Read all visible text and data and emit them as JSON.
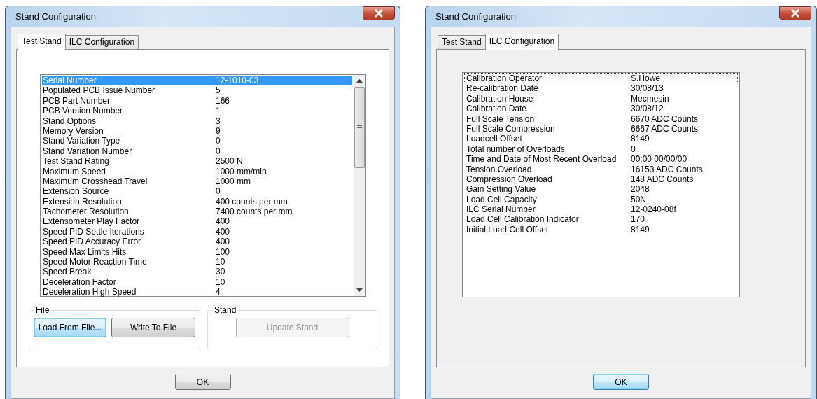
{
  "windows": [
    {
      "title": "Stand Configuration",
      "tabs": [
        {
          "label": "Test Stand",
          "selected": true
        },
        {
          "label": "ILC Configuration",
          "selected": false
        }
      ],
      "list": {
        "scrollbar": true,
        "rows": [
          {
            "name": "Serial Number",
            "value": "12-1010-03",
            "selected": true,
            "focused": false
          },
          {
            "name": "Populated PCB Issue Number",
            "value": "5",
            "selected": false,
            "focused": false
          },
          {
            "name": "PCB Part Number",
            "value": "166",
            "selected": false,
            "focused": false
          },
          {
            "name": "PCB Version Number",
            "value": "1",
            "selected": false,
            "focused": false
          },
          {
            "name": "Stand Options",
            "value": "3",
            "selected": false,
            "focused": false
          },
          {
            "name": "Memory Version",
            "value": "9",
            "selected": false,
            "focused": false
          },
          {
            "name": "Stand Variation Type",
            "value": "0",
            "selected": false,
            "focused": false
          },
          {
            "name": "Stand Variation Number",
            "value": "0",
            "selected": false,
            "focused": false
          },
          {
            "name": "Test Stand Rating",
            "value": "2500 N",
            "selected": false,
            "focused": false
          },
          {
            "name": "Maximum Speed",
            "value": "1000 mm/min",
            "selected": false,
            "focused": false
          },
          {
            "name": "Maximum Crosshead Travel",
            "value": "1000 mm",
            "selected": false,
            "focused": false
          },
          {
            "name": "Extension Source",
            "value": "0",
            "selected": false,
            "focused": false
          },
          {
            "name": "Extension Resolution",
            "value": "400 counts per mm",
            "selected": false,
            "focused": false
          },
          {
            "name": "Tachometer Resolution",
            "value": "7400 counts per mm",
            "selected": false,
            "focused": false
          },
          {
            "name": "Extensometer Play Factor",
            "value": "400",
            "selected": false,
            "focused": false
          },
          {
            "name": "Speed PID Settle Iterations",
            "value": "400",
            "selected": false,
            "focused": false
          },
          {
            "name": "Speed PID Accuracy Error",
            "value": "400",
            "selected": false,
            "focused": false
          },
          {
            "name": "Speed Max Limits Hits",
            "value": "100",
            "selected": false,
            "focused": false
          },
          {
            "name": "Speed Motor Reaction Time",
            "value": "10",
            "selected": false,
            "focused": false
          },
          {
            "name": "Speed Break",
            "value": "30",
            "selected": false,
            "focused": false
          },
          {
            "name": "Deceleration Factor",
            "value": "10",
            "selected": false,
            "focused": false
          },
          {
            "name": "Deceleration High Speed",
            "value": "4",
            "selected": false,
            "focused": false
          }
        ]
      },
      "groups": [
        {
          "label": "File",
          "buttons": [
            {
              "label": "Load From File...",
              "focused": true,
              "disabled": false
            },
            {
              "label": "Write To File",
              "focused": false,
              "disabled": false
            }
          ]
        },
        {
          "label": "Stand",
          "buttons": [
            {
              "label": "Update Stand",
              "focused": false,
              "disabled": true
            }
          ]
        }
      ],
      "ok": {
        "label": "OK",
        "focused": false
      }
    },
    {
      "title": "Stand Configuration",
      "tabs": [
        {
          "label": "Test Stand",
          "selected": false
        },
        {
          "label": "ILC Configuration",
          "selected": true
        }
      ],
      "list": {
        "rows": [
          {
            "name": "Calibration Operator",
            "value": "S.Howe",
            "selected": false,
            "focused": true
          },
          {
            "name": "Re-calibration Date",
            "value": "30/08/13",
            "selected": false,
            "focused": false
          },
          {
            "name": "Calibration House",
            "value": "Mecmesin",
            "selected": false,
            "focused": false
          },
          {
            "name": "Calibration Date",
            "value": "30/08/12",
            "selected": false,
            "focused": false
          },
          {
            "name": "Full Scale Tension",
            "value": "6670 ADC Counts",
            "selected": false,
            "focused": false
          },
          {
            "name": "Full Scale Compression",
            "value": "6667 ADC Counts",
            "selected": false,
            "focused": false
          },
          {
            "name": "Loadcell Offset",
            "value": "8149",
            "selected": false,
            "focused": false
          },
          {
            "name": "Total number of Overloads",
            "value": "0",
            "selected": false,
            "focused": false
          },
          {
            "name": "Time and Date of Most Recent Overload",
            "value": "00:00 00/00/00",
            "selected": false,
            "focused": false
          },
          {
            "name": "Tension Overload",
            "value": "16153 ADC Counts",
            "selected": false,
            "focused": false
          },
          {
            "name": "Compression Overload",
            "value": "148 ADC Counts",
            "selected": false,
            "focused": false
          },
          {
            "name": "Gain Setting Value",
            "value": "2048",
            "selected": false,
            "focused": false
          },
          {
            "name": "Load Cell Capacity",
            "value": "50N",
            "selected": false,
            "focused": false
          },
          {
            "name": "ILC Serial Number",
            "value": "12-0240-08f",
            "selected": false,
            "focused": false
          },
          {
            "name": "Load Cell Calibration Indicator",
            "value": "170",
            "selected": false,
            "focused": false
          },
          {
            "name": "Initial Load Cell Offset",
            "value": "8149",
            "selected": false,
            "focused": false
          }
        ]
      },
      "ok": {
        "label": "OK",
        "focused": true
      }
    }
  ]
}
